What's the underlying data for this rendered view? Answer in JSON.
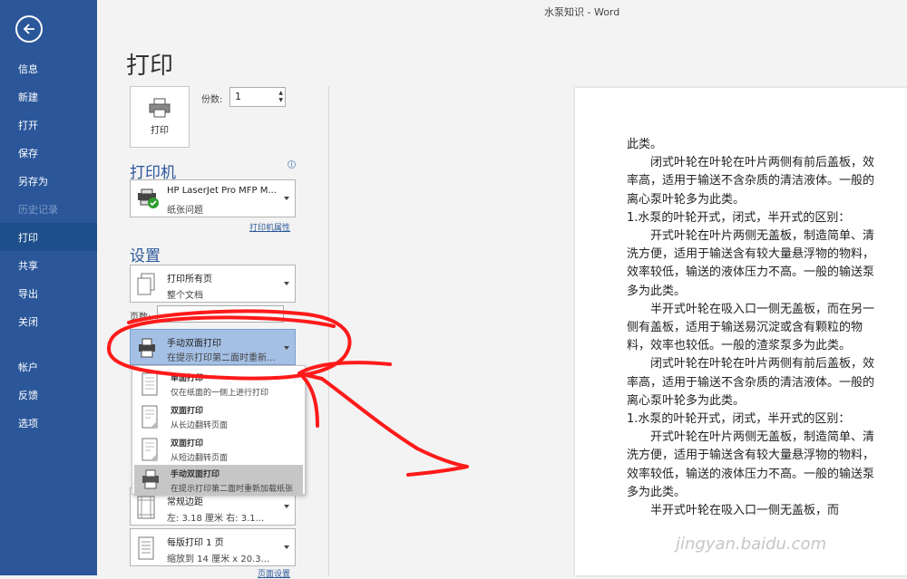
{
  "window": {
    "title": "水泵知识 - Word"
  },
  "sidebar": {
    "items": [
      {
        "label": "信息",
        "state": "normal"
      },
      {
        "label": "新建",
        "state": "normal"
      },
      {
        "label": "打开",
        "state": "normal"
      },
      {
        "label": "保存",
        "state": "normal"
      },
      {
        "label": "另存为",
        "state": "normal"
      },
      {
        "label": "历史记录",
        "state": "disabled"
      },
      {
        "label": "打印",
        "state": "active"
      },
      {
        "label": "共享",
        "state": "normal"
      },
      {
        "label": "导出",
        "state": "normal"
      },
      {
        "label": "关闭",
        "state": "normal"
      },
      {
        "label": "帐户",
        "state": "normal"
      },
      {
        "label": "反馈",
        "state": "normal"
      },
      {
        "label": "选项",
        "state": "normal"
      }
    ]
  },
  "page_title": "打印",
  "print_button": {
    "label": "打印"
  },
  "copies": {
    "label": "份数:",
    "value": "1"
  },
  "printer": {
    "section_title": "打印机",
    "name": "HP LaserJet Pro MFP M...",
    "status": "纸张问题",
    "properties_link": "打印机属性"
  },
  "settings": {
    "section_title": "设置",
    "pages_scope": {
      "line1": "打印所有页",
      "line2": "整个文档"
    },
    "pages_label": "页数:",
    "duplex": {
      "line1": "手动双面打印",
      "line2": "在提示打印第二面时重新..."
    },
    "duplex_options": [
      {
        "title": "单面打印",
        "desc": "仅在纸面的一侧上进行打印"
      },
      {
        "title": "双面打印",
        "desc": "从长边翻转页面"
      },
      {
        "title": "双面打印",
        "desc": "从短边翻转页面"
      },
      {
        "title": "手动双面打印",
        "desc": "在提示打印第二面时重新加载纸张"
      }
    ],
    "margins": {
      "line1": "常规边距",
      "line2": "左: 3.18 厘米   右: 3.1..."
    },
    "per_sheet": {
      "line1": "每版打印 1 页",
      "line2": "缩放到 14 厘米 x 20.3..."
    },
    "page_setup_link": "页面设置"
  },
  "document": {
    "paragraphs": [
      {
        "text": "此类。",
        "indent": false
      },
      {
        "text": "闭式叶轮在叶轮在叶片两侧有前后盖板，效率高，适用于输送不含杂质的清洁液体。一般的离心泵叶轮多为此类。",
        "indent": true
      },
      {
        "text": "1.水泵的叶轮开式，闭式，半开式的区别：",
        "indent": false
      },
      {
        "text": "开式叶轮在叶片两侧无盖板，制造简单、清洗方便，适用于输送含有较大量悬浮物的物料，效率较低，输送的液体压力不高。一般的输送泵多为此类。",
        "indent": true
      },
      {
        "text": "半开式叶轮在吸入口一侧无盖板，而在另一侧有盖板，适用于输送易沉淀或含有颗粒的物料，效率也较低。一般的渣浆泵多为此类。",
        "indent": true
      },
      {
        "text": "闭式叶轮在叶轮在叶片两侧有前后盖板，效率高，适用于输送不含杂质的清洁液体。一般的离心泵叶轮多为此类。",
        "indent": true
      },
      {
        "text": "1.水泵的叶轮开式，闭式，半开式的区别：",
        "indent": false
      },
      {
        "text": "开式叶轮在叶片两侧无盖板，制造简单、清洗方便，适用于输送含有较大量悬浮物的物料，效率较低，输送的液体压力不高。一般的输送泵多为此类。",
        "indent": true
      },
      {
        "text": "半开式叶轮在吸入口一侧无盖板，而",
        "indent": true
      }
    ]
  },
  "watermark": "jingyan.baidu.com",
  "colors": {
    "sidebar": "#2b579a",
    "selected": "#a5c0e5",
    "annotation": "#ff1a1a"
  }
}
